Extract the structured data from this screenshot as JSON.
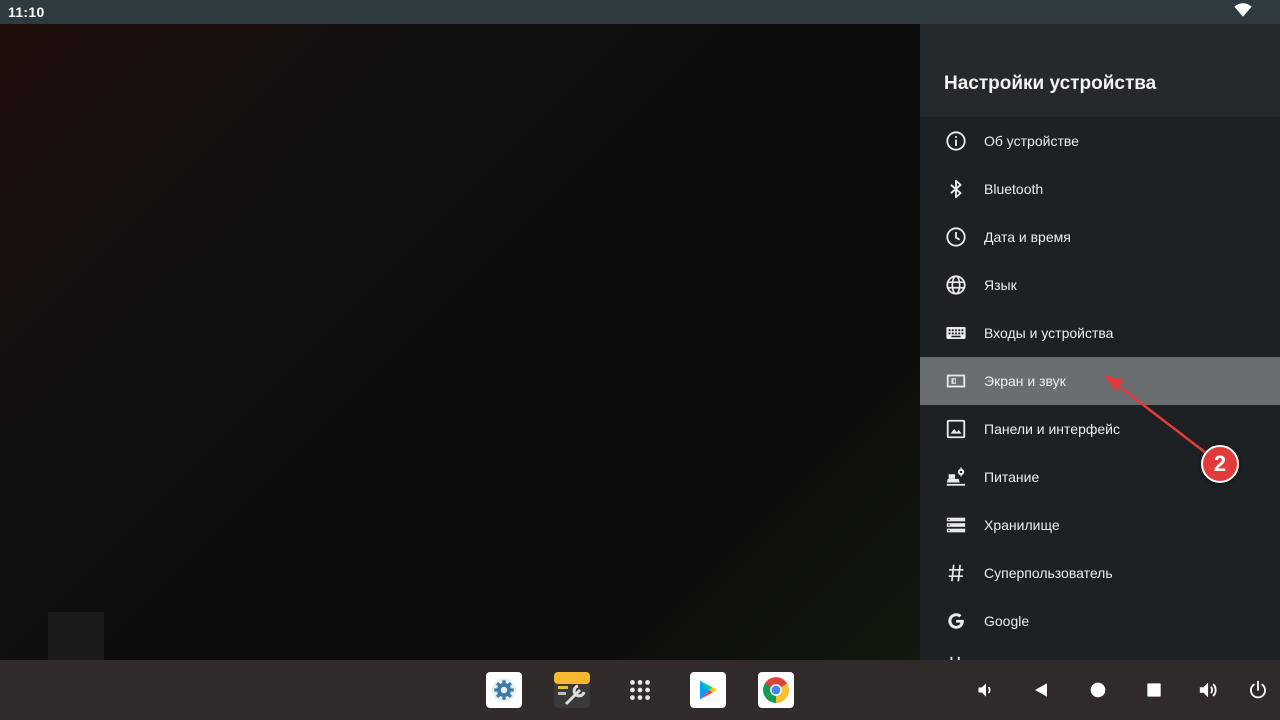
{
  "status_bar": {
    "time": "11:10"
  },
  "settings": {
    "title": "Настройки устройства",
    "items": [
      {
        "label": "Об устройстве",
        "icon": "info-icon"
      },
      {
        "label": "Bluetooth",
        "icon": "bluetooth-icon"
      },
      {
        "label": "Дата и время",
        "icon": "clock-icon"
      },
      {
        "label": "Язык",
        "icon": "globe-icon"
      },
      {
        "label": "Входы и устройства",
        "icon": "keyboard-icon"
      },
      {
        "label": "Экран и звук",
        "icon": "display-icon",
        "selected": true
      },
      {
        "label": "Панели и интерфейс",
        "icon": "image-icon"
      },
      {
        "label": "Питание",
        "icon": "power-settings-icon"
      },
      {
        "label": "Хранилище",
        "icon": "storage-icon"
      },
      {
        "label": "Суперпользователь",
        "icon": "hash-icon"
      },
      {
        "label": "Google",
        "icon": "google-icon"
      }
    ]
  },
  "taskbar": {
    "apps": [
      "settings-app-icon",
      "toolbox-app-icon",
      "app-drawer-icon",
      "play-store-icon",
      "chrome-icon"
    ],
    "nav": [
      "volume-down-icon",
      "back-icon",
      "home-icon",
      "recents-icon",
      "volume-up-icon",
      "power-icon"
    ]
  },
  "annotation": {
    "badge": "2",
    "color": "#e23b3b"
  }
}
